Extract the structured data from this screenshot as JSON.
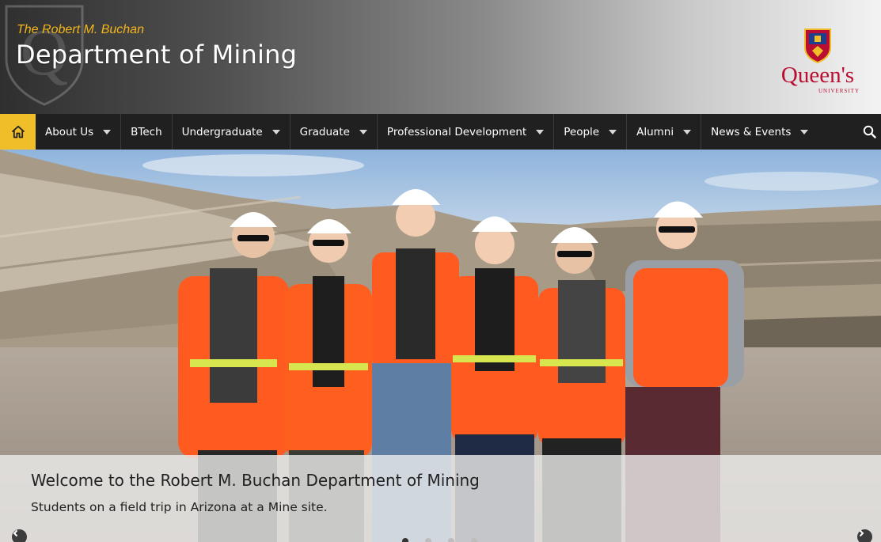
{
  "header": {
    "subtitle": "The Robert M. Buchan",
    "title": "Department of Mining",
    "university_logo_text": "Queen's",
    "university_logo_subtext": "UNIVERSITY"
  },
  "nav": {
    "home_icon": "home-icon",
    "items": [
      {
        "label": "About Us",
        "dropdown": true
      },
      {
        "label": "BTech",
        "dropdown": false
      },
      {
        "label": "Undergraduate",
        "dropdown": true
      },
      {
        "label": "Graduate",
        "dropdown": true
      },
      {
        "label": "Professional Development",
        "dropdown": true
      },
      {
        "label": "People",
        "dropdown": true
      },
      {
        "label": "Alumni",
        "dropdown": true
      },
      {
        "label": "News & Events",
        "dropdown": true
      }
    ],
    "search_icon": "search-icon"
  },
  "hero": {
    "caption_title": "Welcome to the Robert M. Buchan Department of Mining",
    "caption_text": "Students on a field trip in Arizona at a Mine site.",
    "slide_count": 4,
    "active_slide": 1
  },
  "colors": {
    "accent_gold": "#f0be28",
    "subtitle_gold": "#f4b71a",
    "nav_bg": "#202020",
    "queens_red": "#b90e31"
  }
}
